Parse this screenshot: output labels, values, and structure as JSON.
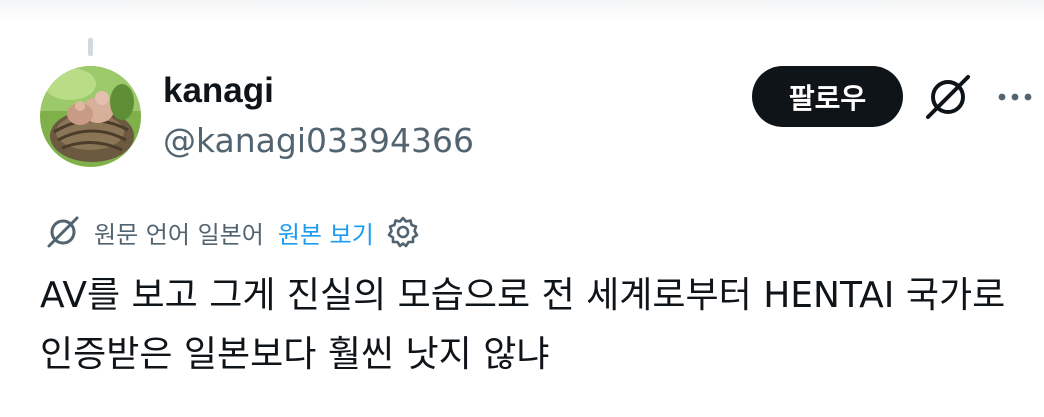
{
  "author": {
    "display_name": "kanagi",
    "handle": "@kanagi03394366",
    "avatar_icon": "bird-nest-avatar"
  },
  "actions": {
    "follow_label": "팔로우",
    "grok_icon": "slashed-circle-icon",
    "more_icon": "more-dots-icon"
  },
  "translation": {
    "info": "원문 언어 일본어",
    "show_original": "원본 보기",
    "settings_icon": "gear-icon"
  },
  "tweet": {
    "text": "AV를 보고 그게 진실의 모습으로 전 세계로부터 HENTAI 국가로 인증받은 일본보다 훨씬 낫지 않냐"
  },
  "colors": {
    "text": "#0f1419",
    "secondary": "#536471",
    "link": "#1d9bf0",
    "button_bg": "#0f1419"
  }
}
